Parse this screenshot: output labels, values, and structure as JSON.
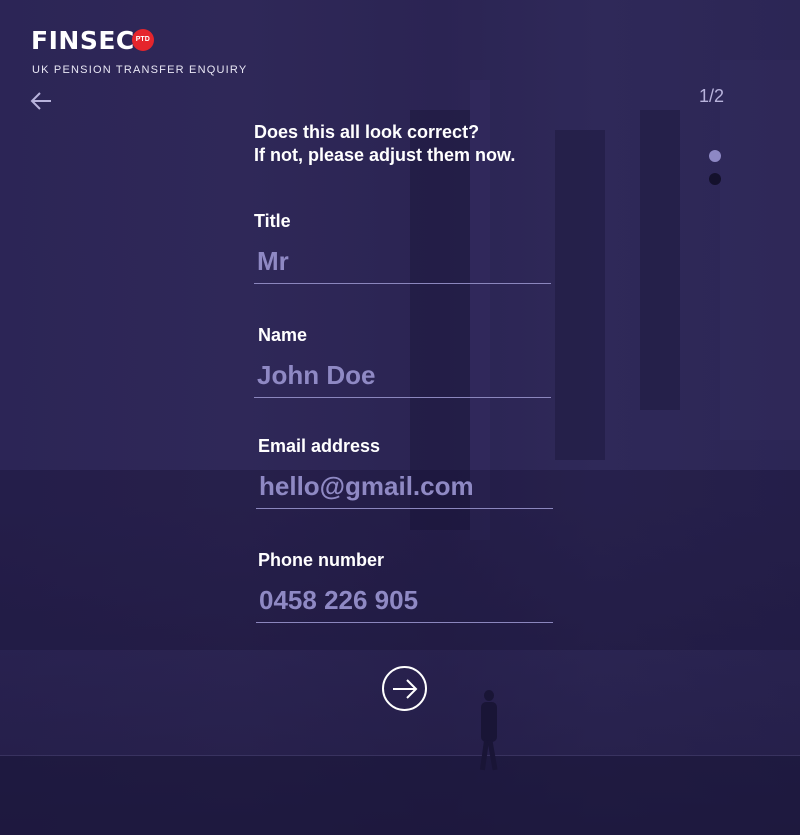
{
  "brand": {
    "logo_fin": "FIN",
    "logo_sec": "SEC",
    "badge": "PTD",
    "subtitle": "UK PENSION TRANSFER ENQUIRY"
  },
  "nav": {
    "back_icon": "arrow-left-icon",
    "step": "1/2",
    "progress": {
      "current": 1,
      "total": 2
    }
  },
  "form": {
    "heading_line1": "Does this all look correct?",
    "heading_line2": "If not, please adjust them now.",
    "fields": {
      "title": {
        "label": "Title",
        "value": "Mr"
      },
      "name": {
        "label": "Name",
        "value": "John Doe"
      },
      "email": {
        "label": "Email address",
        "value": "hello@gmail.com"
      },
      "phone": {
        "label": "Phone number",
        "value": "0458 226 905"
      }
    },
    "next_icon": "arrow-right-circle-icon"
  },
  "colors": {
    "background": "#2c2556",
    "accent": "#8f89c4",
    "badge": "#e5252c"
  }
}
